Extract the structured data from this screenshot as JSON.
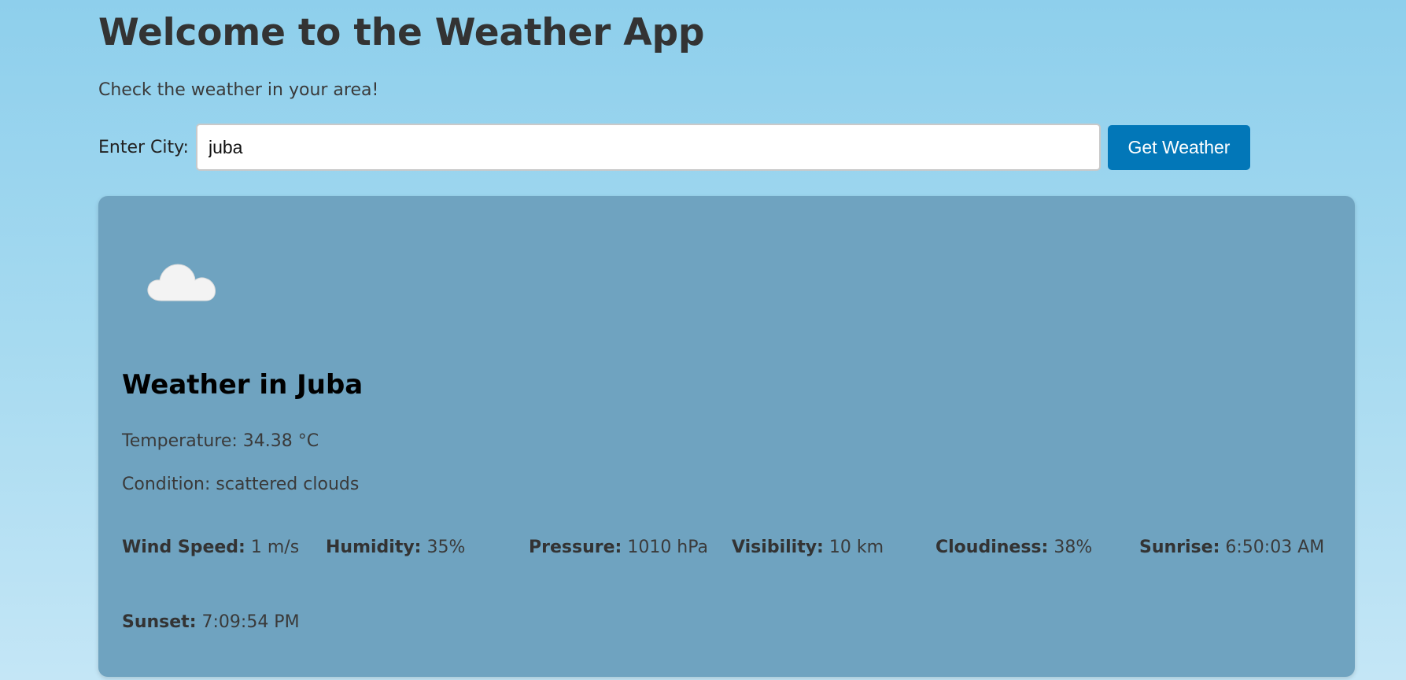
{
  "header": {
    "title": "Welcome to the Weather App",
    "subtitle": "Check the weather in your area!"
  },
  "search": {
    "label": "Enter City:",
    "value": "juba",
    "button_label": "Get Weather"
  },
  "weather": {
    "icon": "cloud-icon",
    "heading": "Weather in Juba",
    "temperature": "Temperature: 34.38 °C",
    "condition": "Condition: scattered clouds",
    "details": [
      {
        "label": "Wind Speed:",
        "value": "1 m/s"
      },
      {
        "label": "Humidity:",
        "value": "35%"
      },
      {
        "label": "Pressure:",
        "value": "1010 hPa"
      },
      {
        "label": "Visibility:",
        "value": "10 km"
      },
      {
        "label": "Cloudiness:",
        "value": "38%"
      },
      {
        "label": "Sunrise:",
        "value": "6:50:03 AM"
      },
      {
        "label": "Sunset:",
        "value": "7:09:54 PM"
      }
    ]
  },
  "colors": {
    "card_background": "#6fa3c0",
    "button_background": "#0277b8",
    "page_gradient_top": "#8ecfec",
    "page_gradient_bottom": "#c4e6f6"
  }
}
